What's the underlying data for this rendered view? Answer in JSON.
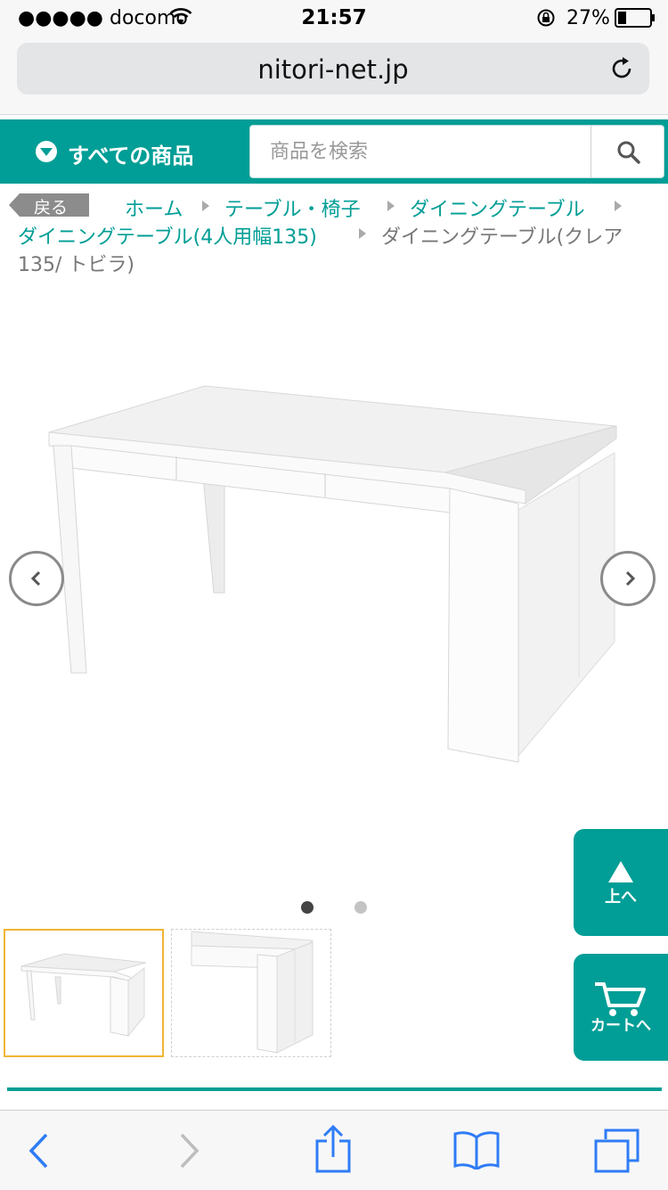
{
  "status_bar": {
    "carrier": "●●●●● docomo",
    "time": "21:57",
    "battery_percent": "27%",
    "battery_level": 0.27
  },
  "browser": {
    "url": "nitori-net.jp"
  },
  "header": {
    "all_products_label": "すべての商品",
    "search_placeholder": "商品を検索"
  },
  "breadcrumb": {
    "back_label": "戻る",
    "items": [
      "ホーム",
      "テーブル・椅子",
      "ダイニングテーブル",
      "ダイニングテーブル(4人用幅135)"
    ],
    "current_line1": "ダイニングテーブル(クレア",
    "current_line2": "135/ トビラ)"
  },
  "carousel": {
    "total_pages": 2,
    "current_page": 1
  },
  "side_buttons": {
    "to_top": "上へ",
    "to_cart": "カートへ"
  },
  "colors": {
    "brand_teal": "#009e96",
    "ios_blue": "#2f7cf6"
  }
}
